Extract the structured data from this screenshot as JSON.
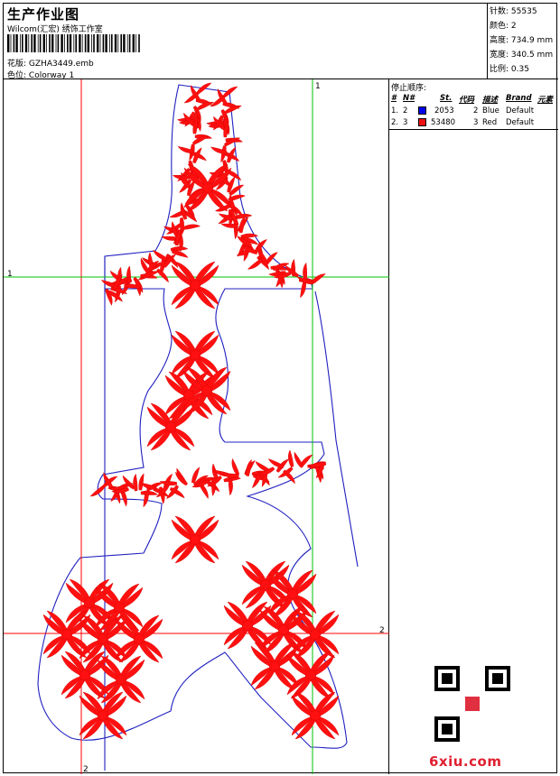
{
  "header": {
    "title": "生产作业图",
    "subtitle": "Wilcom(汇宏) 绣饰工作室",
    "design_label": "花版:",
    "design_value": "GZHA3449.emb",
    "colorway_label": "色位:",
    "colorway_value": "Colorway 1"
  },
  "stats": [
    {
      "label": "针数:",
      "value": "55535"
    },
    {
      "label": "颜色:",
      "value": "2"
    },
    {
      "label": "高度:",
      "value": "734.9 mm"
    },
    {
      "label": "宽度:",
      "value": "340.5 mm"
    },
    {
      "label": "比例:",
      "value": "0.35"
    }
  ],
  "guides": {
    "top_marker": "1",
    "left_marker": "1",
    "right_marker": "2",
    "bottom_marker": "2"
  },
  "stop_sequence": {
    "heading": "停止顺序:",
    "columns": [
      "#",
      "N#",
      "St.",
      "代码",
      "描述",
      "Brand",
      "元素"
    ],
    "rows": [
      {
        "index": "1.",
        "needle": "2",
        "swatch_color": "#0000ee",
        "stitches": "2053",
        "code": "2",
        "description": "Blue",
        "brand": "Default",
        "element": ""
      },
      {
        "index": "2.",
        "needle": "3",
        "swatch_color": "#ee1111",
        "stitches": "53480",
        "code": "3",
        "description": "Red",
        "brand": "Default",
        "element": ""
      }
    ]
  },
  "watermark": "6xiu.com",
  "colors": {
    "embroidery_red": "#ff1010",
    "outline_blue": "#2020c0",
    "guide_red": "#ff0000",
    "guide_green": "#00c000"
  }
}
